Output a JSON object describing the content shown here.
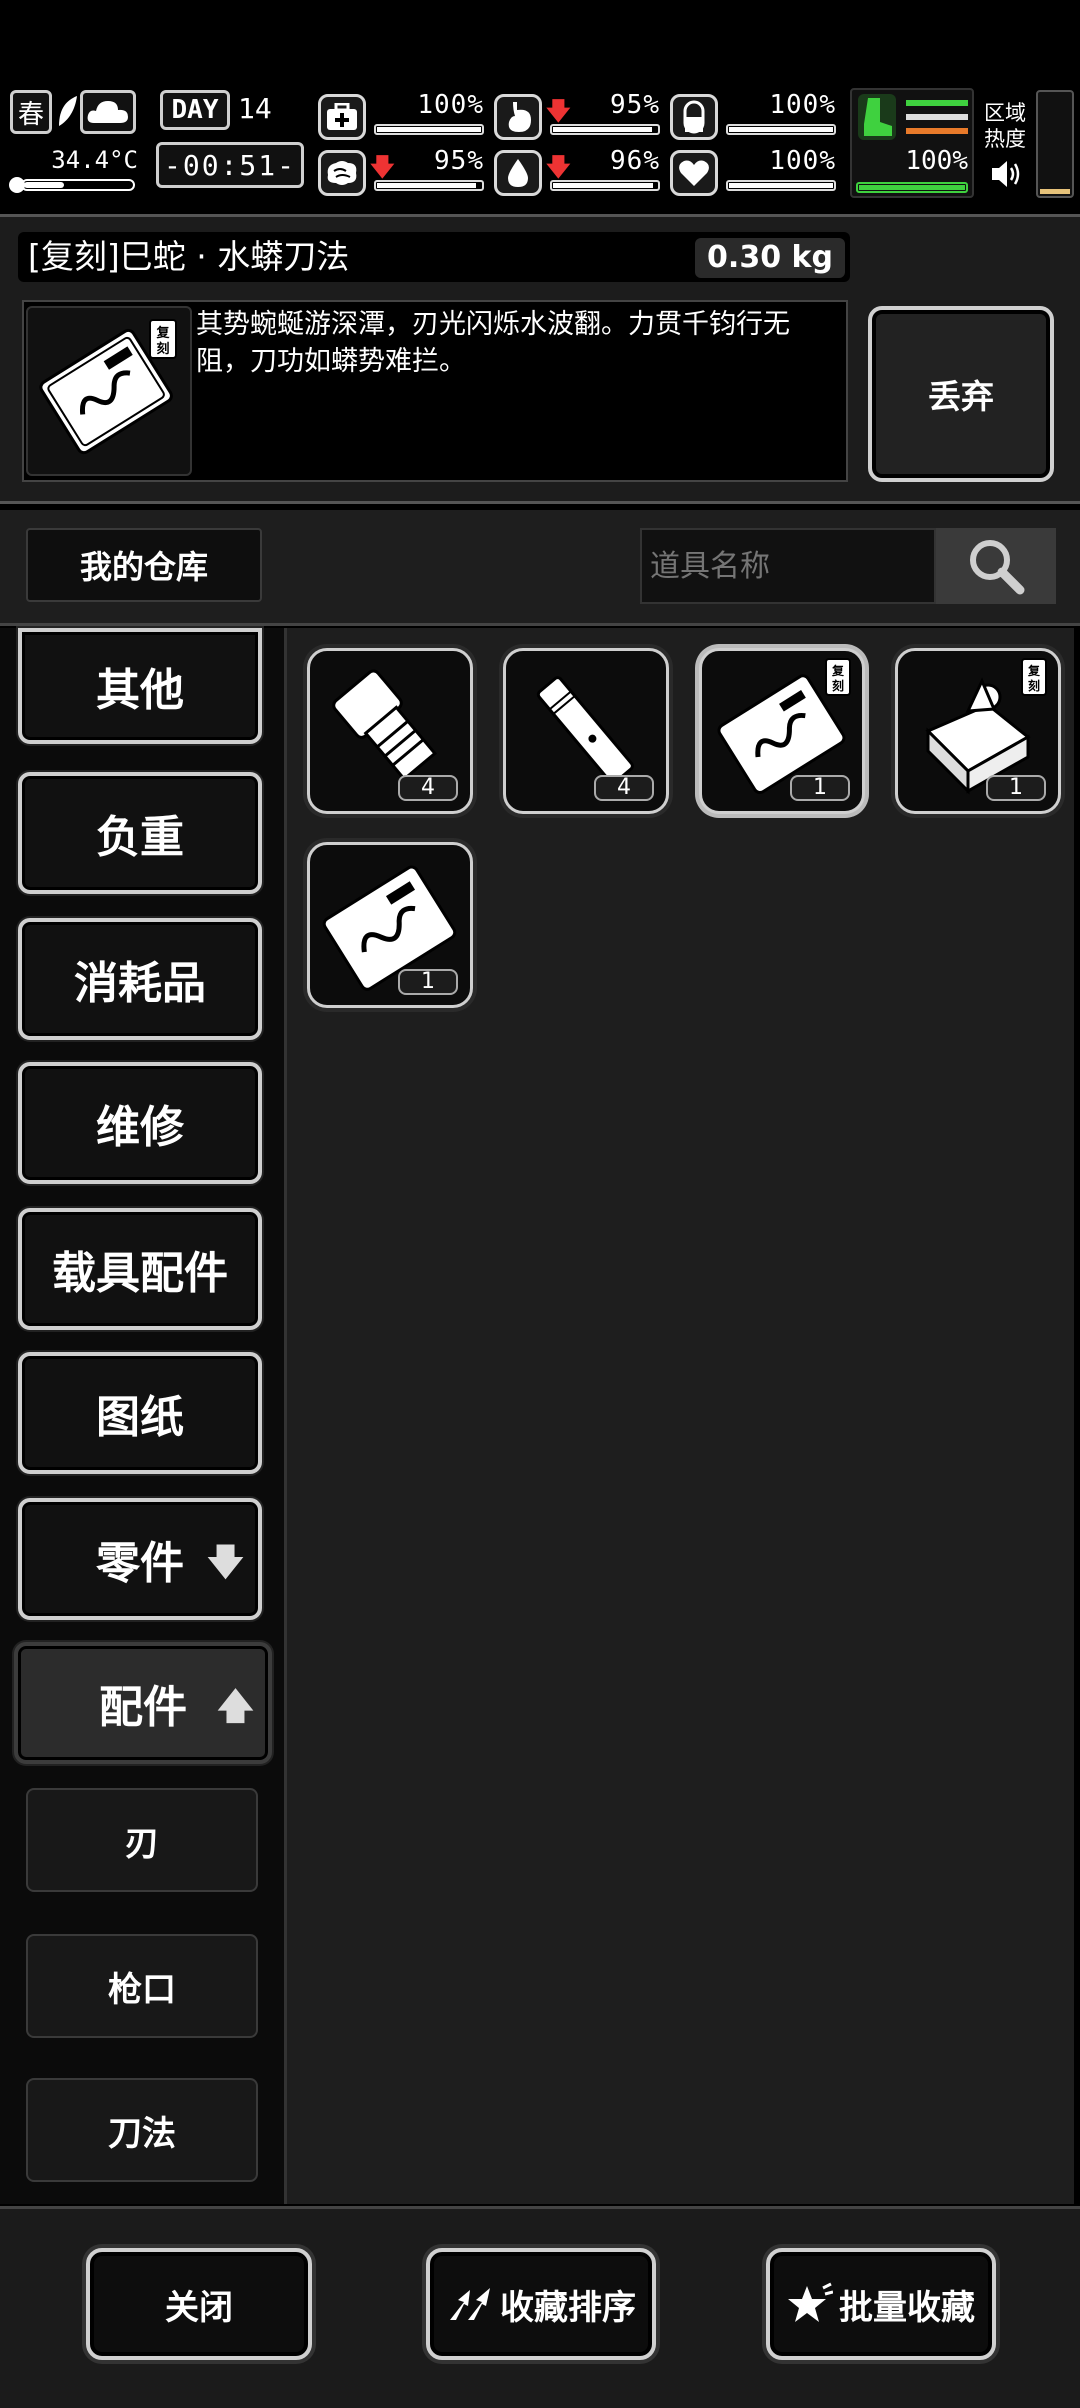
{
  "hud": {
    "season": "春",
    "temperature": "34.4°C",
    "day_label": "DAY",
    "day_number": "14",
    "clock": "-00:51-",
    "region_heat_label": "区域\n热度",
    "stats": [
      {
        "icon": "medkit-icon",
        "value": "100%",
        "fill": 1.0,
        "down": false
      },
      {
        "icon": "stomach-icon",
        "value": "95%",
        "fill": 0.95,
        "down": true
      },
      {
        "icon": "pill-icon",
        "value": "100%",
        "fill": 1.0,
        "down": false
      },
      {
        "icon": "brain-icon",
        "value": "95%",
        "fill": 0.95,
        "down": true
      },
      {
        "icon": "water-drop-icon",
        "value": "96%",
        "fill": 0.96,
        "down": true
      },
      {
        "icon": "heart-icon",
        "value": "100%",
        "fill": 1.0,
        "down": false
      }
    ],
    "stamina": {
      "value": "100%",
      "fill": 1.0
    },
    "heat_level": 0.05
  },
  "item": {
    "title": "[复刻]巳蛇 · 水蟒刀法",
    "weight": "0.30 kg",
    "description": "其势蜿蜒游深潭，刃光闪烁水波翻。力贯千钧行无阻，刀功如蟒势难拦。",
    "discard_label": "丢弃",
    "tag": "复刻"
  },
  "storage": {
    "title": "我的仓库",
    "search_placeholder": "道具名称"
  },
  "categories": [
    {
      "label": "其他"
    },
    {
      "label": "负重"
    },
    {
      "label": "消耗品"
    },
    {
      "label": "维修"
    },
    {
      "label": "载具配件"
    },
    {
      "label": "图纸"
    },
    {
      "label": "零件",
      "arrow": "🡇"
    },
    {
      "label": "配件",
      "arrow": "🡅"
    }
  ],
  "subcategories": [
    {
      "label": "刃"
    },
    {
      "label": "枪口"
    },
    {
      "label": "刀法"
    }
  ],
  "items": [
    {
      "name": "flashlight-item",
      "count": "4"
    },
    {
      "name": "suppressor-item",
      "count": "4"
    },
    {
      "name": "blade-manual-item",
      "count": "1",
      "selected": true,
      "tag": "复刻"
    },
    {
      "name": "supply-bag-item",
      "count": "1",
      "tag": "复刻"
    },
    {
      "name": "blade-manual-item-2",
      "count": "1"
    }
  ],
  "buttons": {
    "close": "关闭",
    "sort_favorites": "收藏排序",
    "batch_favorite": "批量收藏"
  },
  "colors": {
    "stamina": "#3fd13f",
    "alert_arrow": "#e33333",
    "heat": "#e6c27a"
  }
}
